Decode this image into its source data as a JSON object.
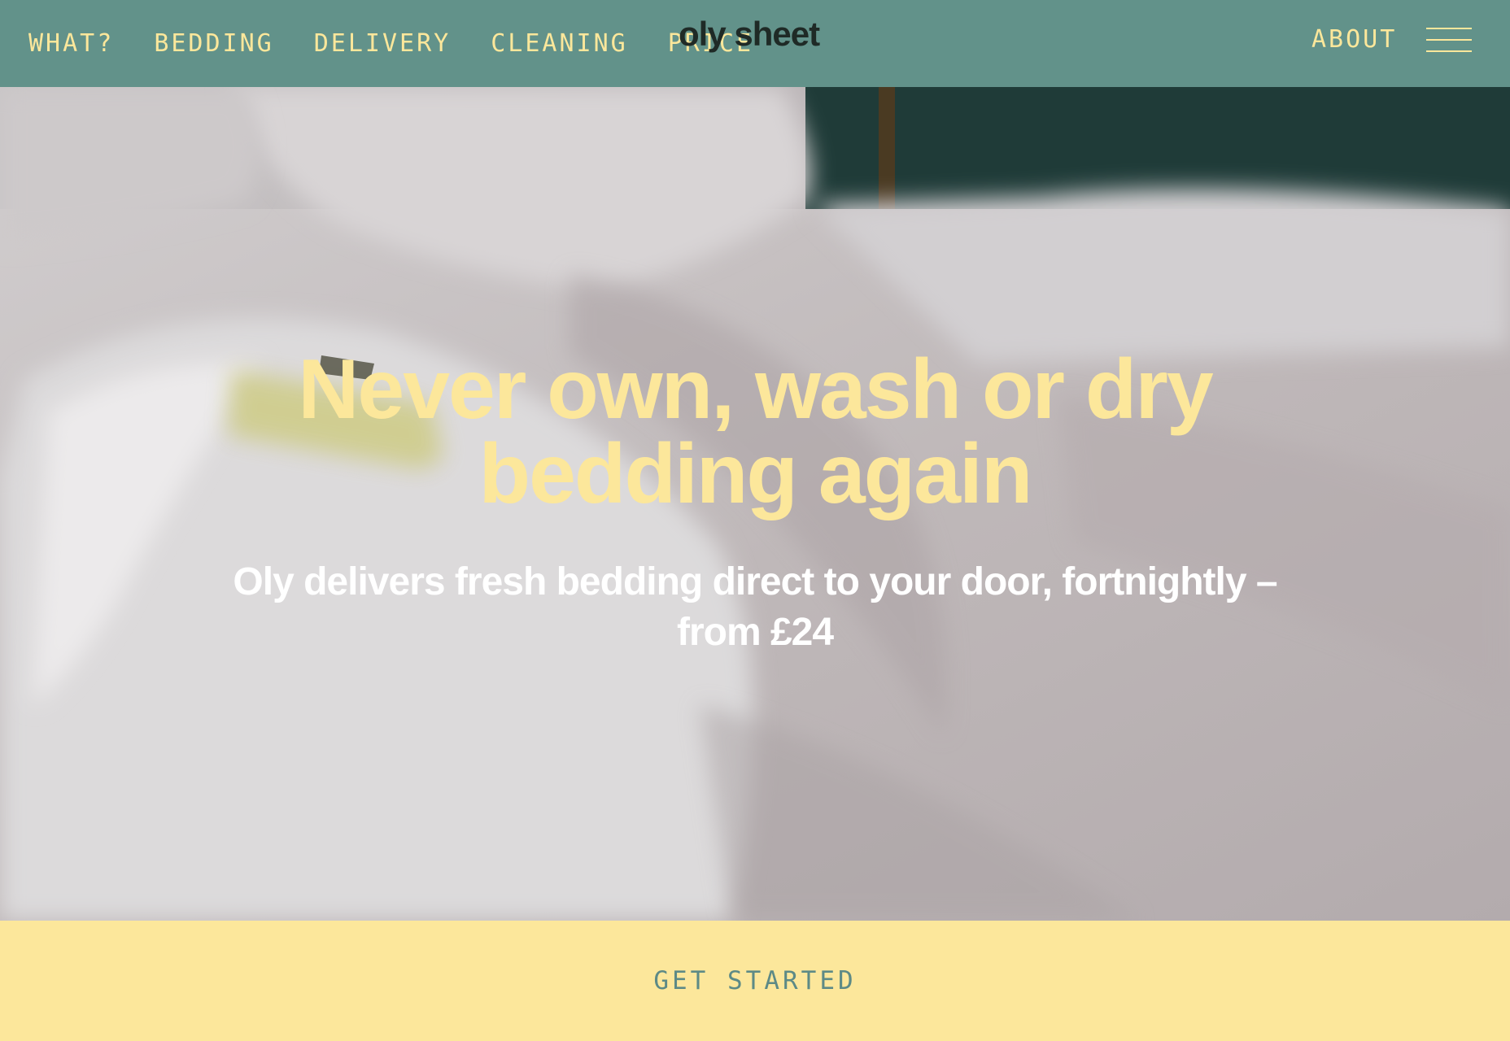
{
  "header": {
    "nav": [
      "WHAT?",
      "BEDDING",
      "DELIVERY",
      "CLEANING",
      "PRICE"
    ],
    "logo": "oly sheet",
    "about": "ABOUT",
    "menu_icon": "hamburger-menu-icon"
  },
  "hero": {
    "title": "Never own, wash or dry bedding again",
    "subtitle": "Oly delivers fresh bedding direct to your door, fortnightly – from £24"
  },
  "cta": {
    "label": "GET STARTED"
  },
  "colors": {
    "header_bg": "#62928a",
    "accent_yellow": "#fce79b",
    "logo_text": "#1f2a26",
    "cta_text": "#5d8a86"
  }
}
